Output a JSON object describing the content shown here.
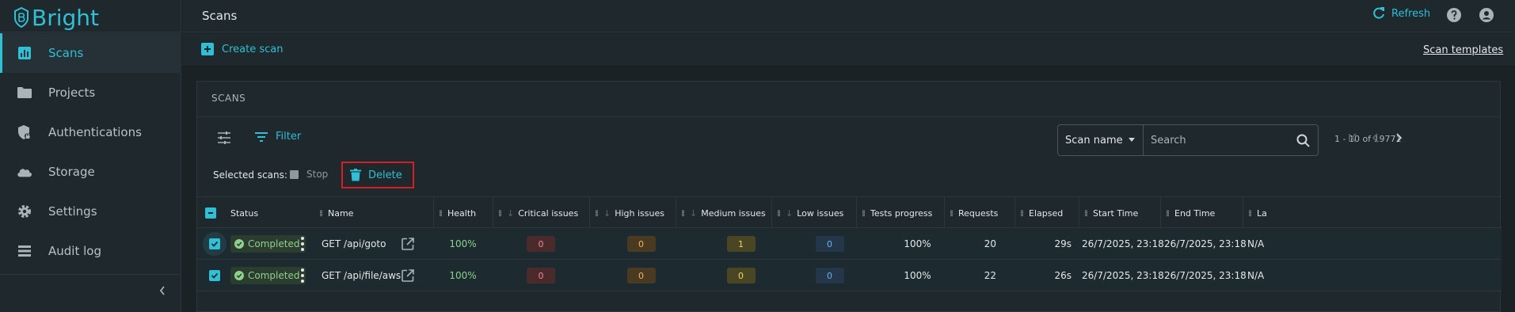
{
  "app": {
    "brand": "Bright"
  },
  "sidebar": {
    "items": [
      {
        "label": "Scans",
        "icon": "chart-icon",
        "active": true
      },
      {
        "label": "Projects",
        "icon": "folder-icon"
      },
      {
        "label": "Authentications",
        "icon": "shield-lock-icon"
      },
      {
        "label": "Storage",
        "icon": "cloud-icon"
      },
      {
        "label": "Settings",
        "icon": "gear-icon"
      },
      {
        "label": "Audit log",
        "icon": "list-icon"
      }
    ]
  },
  "header": {
    "title": "Scans",
    "refresh_label": "Refresh"
  },
  "subheader": {
    "create_label": "Create scan",
    "templates_label": "Scan templates"
  },
  "card": {
    "title": "SCANS",
    "filter_label": "Filter",
    "search": {
      "field_select": "Scan name",
      "placeholder": "Search"
    },
    "pagination": "1 - 10 of 19771",
    "selected_label": "Selected scans:",
    "stop_label": "Stop",
    "delete_label": "Delete"
  },
  "table": {
    "columns": [
      "Status",
      "Name",
      "Health",
      "Critical issues",
      "High issues",
      "Medium issues",
      "Low issues",
      "Tests progress",
      "Requests",
      "Elapsed",
      "Start Time",
      "End Time",
      "La"
    ],
    "rows": [
      {
        "status": "Completed",
        "name": "GET /api/goto",
        "health": "100%",
        "critical": "0",
        "high": "0",
        "medium": "1",
        "low": "0",
        "progress": "100%",
        "requests": "20",
        "elapsed": "29s",
        "start": "26/7/2025, 23:18",
        "end": "26/7/2025, 23:18",
        "last": "N/A"
      },
      {
        "status": "Completed",
        "name": "GET /api/file/aws",
        "health": "100%",
        "critical": "0",
        "high": "0",
        "medium": "0",
        "low": "0",
        "progress": "100%",
        "requests": "22",
        "elapsed": "26s",
        "start": "26/7/2025, 23:18",
        "end": "26/7/2025, 23:18",
        "last": "N/A"
      }
    ]
  },
  "colors": {
    "accent": "#2fc0d6",
    "danger_outline": "#d61e25",
    "success": "#8cd18e"
  }
}
